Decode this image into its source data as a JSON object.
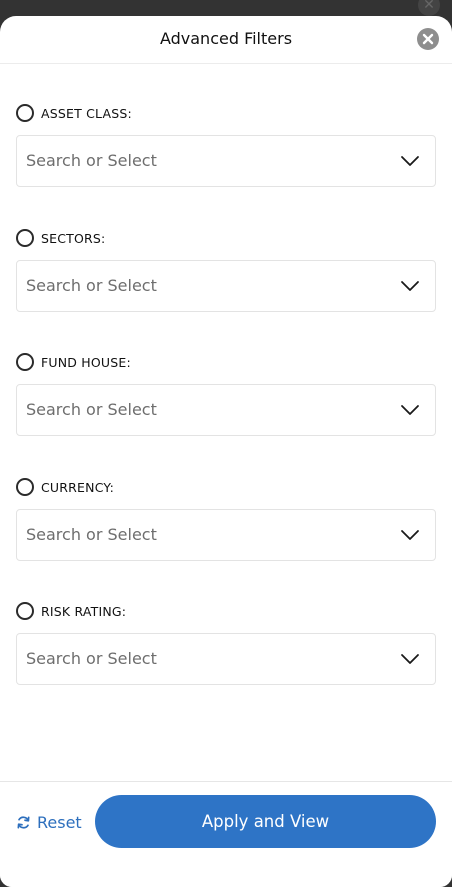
{
  "modal": {
    "title": "Advanced Filters",
    "close_icon": "close-icon"
  },
  "filters": [
    {
      "label": "ASSET CLASS:",
      "placeholder": "Search or Select",
      "checked": false
    },
    {
      "label": "SECTORS:",
      "placeholder": "Search or Select",
      "checked": false
    },
    {
      "label": "FUND HOUSE:",
      "placeholder": "Search or Select",
      "checked": false
    },
    {
      "label": "CURRENCY:",
      "placeholder": "Search or Select",
      "checked": false
    },
    {
      "label": "RISK RATING:",
      "placeholder": "Search or Select",
      "checked": false
    }
  ],
  "footer": {
    "reset_label": "Reset",
    "apply_label": "Apply and View"
  },
  "colors": {
    "accent": "#2e74c6",
    "link": "#2d6fbd",
    "close_bg": "#8e8e8e"
  }
}
